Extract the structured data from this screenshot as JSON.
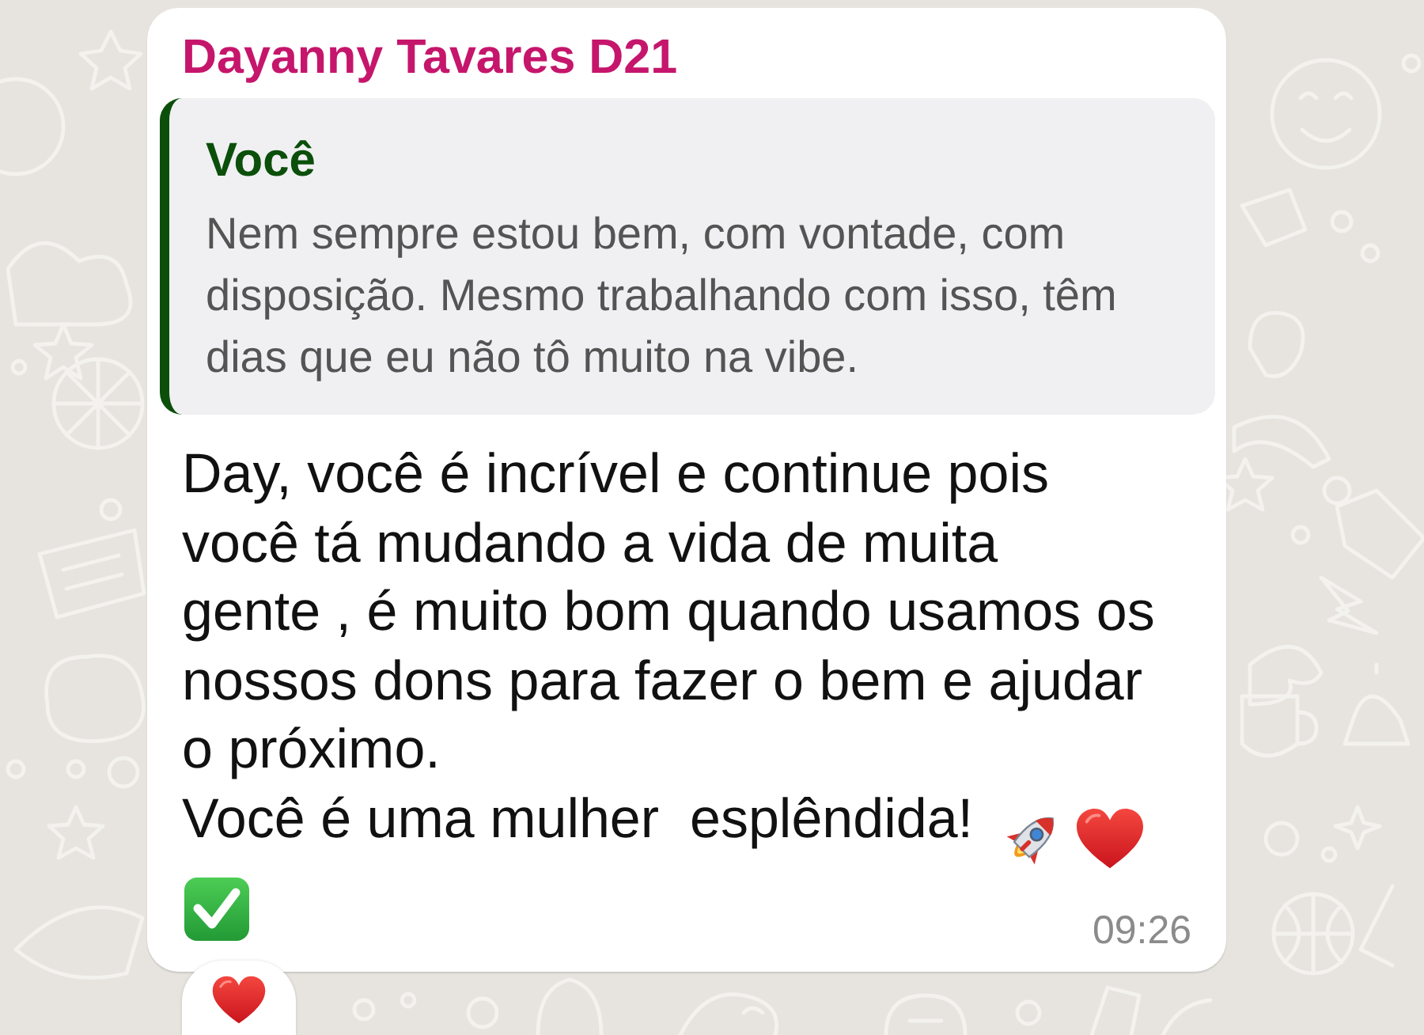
{
  "sender": "Dayanny Tavares D21",
  "quoted_message": {
    "author": "Você",
    "text": "Nem sempre estou bem, com vontade, com disposição. Mesmo trabalhando com isso, têm dias que eu não tô muito na vibe."
  },
  "message_text": [
    "Day, você é incrível e continue pois\nvocê tá mudando a vida de muita\ngente , é muito bom quando usamos os\nnossos dons para fazer o bem e ajudar\no próximo.",
    "Você é uma mulher  esplêndida!"
  ],
  "time": "09:26"
}
